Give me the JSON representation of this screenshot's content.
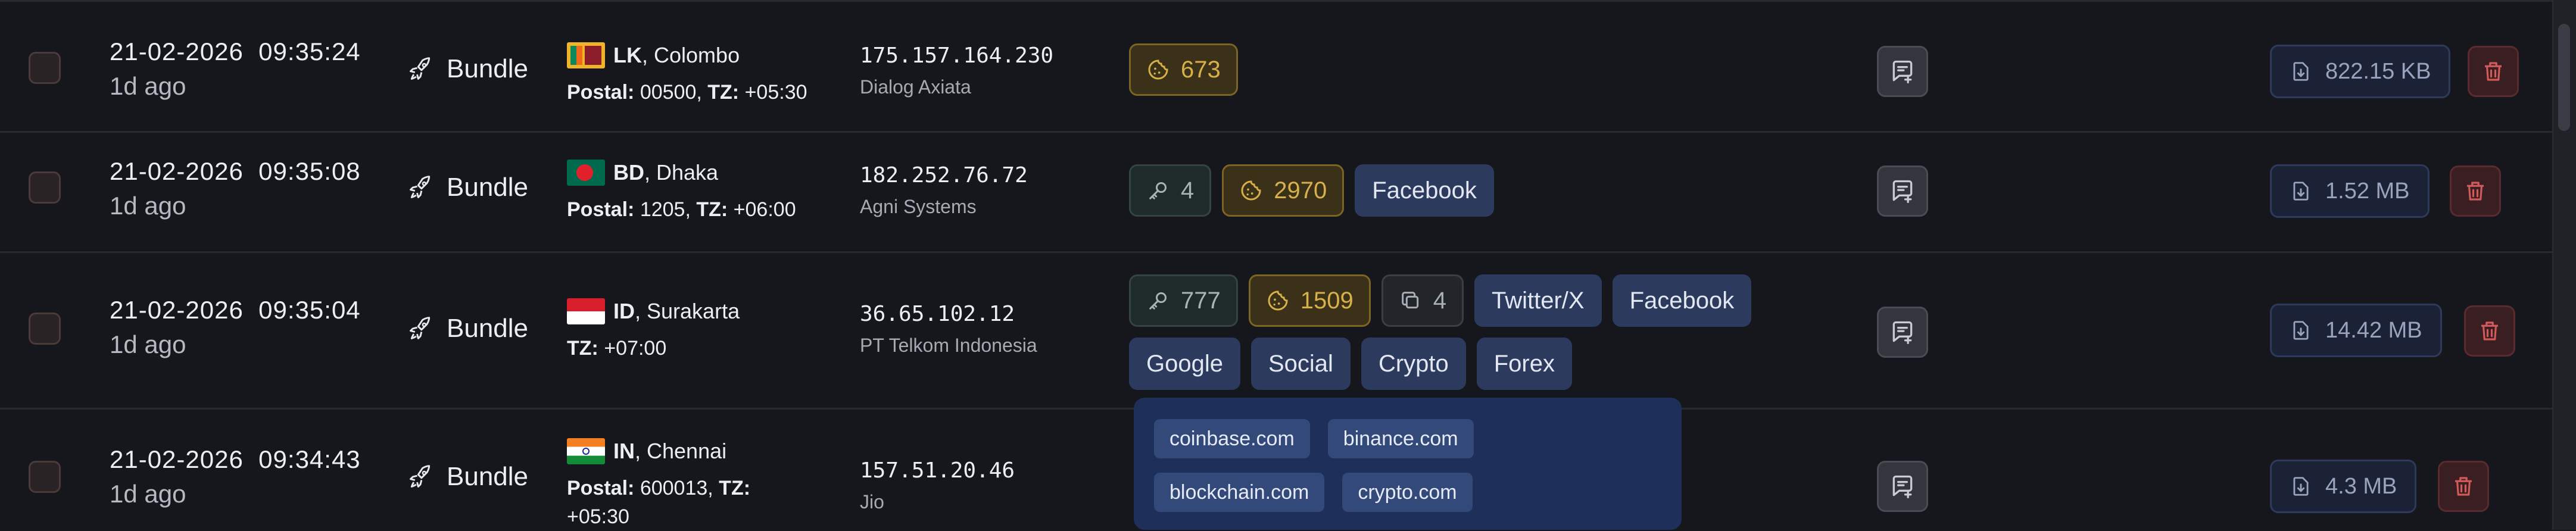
{
  "rows": [
    {
      "date": "21-02-2026  09:35:24",
      "ago": "1d ago",
      "type": "Bundle",
      "country_code": "LK",
      "city": "Colombo",
      "postal_label": "Postal:",
      "postal": "00500,",
      "tz_label": "TZ:",
      "tz": "+05:30",
      "ip": "175.157.164.230",
      "isp": "Dialog Axiata",
      "cookies": "673",
      "size": "822.15 KB"
    },
    {
      "date": "21-02-2026  09:35:08",
      "ago": "1d ago",
      "type": "Bundle",
      "country_code": "BD",
      "city": "Dhaka",
      "postal_label": "Postal:",
      "postal": "1205,",
      "tz_label": "TZ:",
      "tz": "+06:00",
      "ip": "182.252.76.72",
      "isp": "Agni Systems",
      "passwords": "4",
      "cookies": "2970",
      "sites": [
        "Facebook"
      ],
      "size": "1.52 MB"
    },
    {
      "date": "21-02-2026  09:35:04",
      "ago": "1d ago",
      "type": "Bundle",
      "country_code": "ID",
      "city": "Surakarta",
      "tz_label": "TZ:",
      "tz": "+07:00",
      "ip": "36.65.102.12",
      "isp": "PT Telkom Indonesia",
      "passwords": "777",
      "cookies": "1509",
      "copies": "4",
      "sites": [
        "Twitter/X",
        "Facebook",
        "Google",
        "Social",
        "Crypto",
        "Forex"
      ],
      "size": "14.42 MB"
    },
    {
      "date": "21-02-2026  09:34:43",
      "ago": "1d ago",
      "type": "Bundle",
      "country_code": "IN",
      "city": "Chennai",
      "postal_label": "Postal:",
      "postal": "600013,",
      "tz_label": "TZ:",
      "tz": "+05:30",
      "ip": "157.51.20.46",
      "isp": "Jio",
      "size": "4.3 MB"
    }
  ],
  "popup": {
    "domains": [
      "coinbase.com",
      "binance.com",
      "blockchain.com",
      "crypto.com"
    ]
  },
  "icons": {
    "type": "rocket-icon",
    "password": "key-icon",
    "cookie": "cookie-icon",
    "copy": "copy-icon",
    "note": "add-note-icon",
    "download": "download-icon",
    "delete": "trash-icon"
  },
  "colors": {
    "background": "#15171c",
    "cookie_accent": "#d8b04a",
    "site_tag": "#2c3a5e",
    "delete_accent": "#d35a5a",
    "download_accent": "#9aa3bd"
  }
}
